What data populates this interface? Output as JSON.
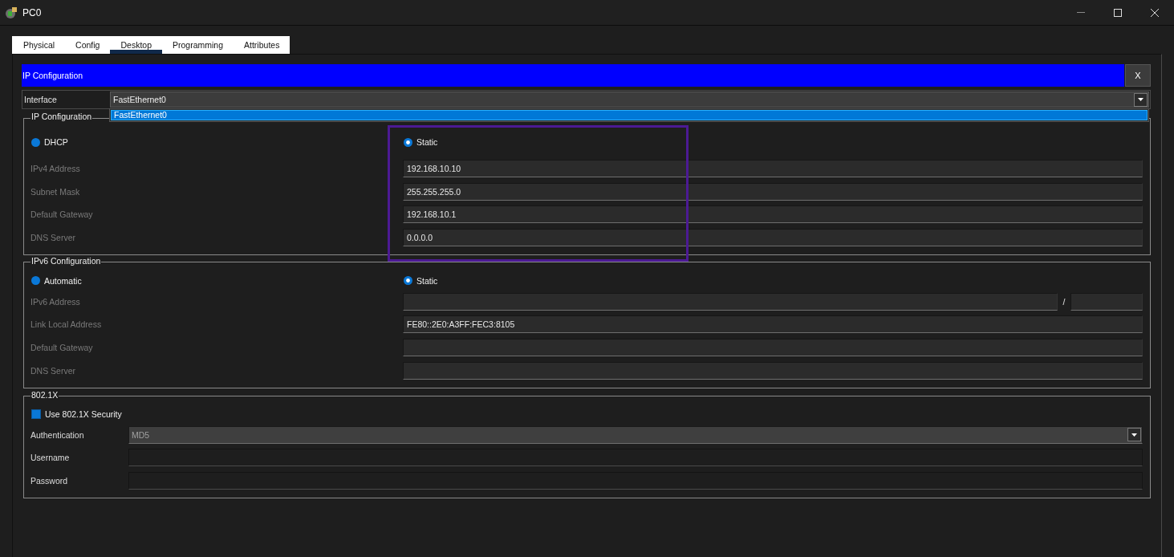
{
  "window": {
    "title": "PC0"
  },
  "tabs": [
    {
      "label": "Physical",
      "selected": false
    },
    {
      "label": "Config",
      "selected": false
    },
    {
      "label": "Desktop",
      "selected": true
    },
    {
      "label": "Programming",
      "selected": false
    },
    {
      "label": "Attributes",
      "selected": false
    }
  ],
  "panel": {
    "title": "IP Configuration",
    "close_label": "X"
  },
  "interface": {
    "label": "Interface",
    "value": "FastEthernet0",
    "expanded": true,
    "options": [
      {
        "label": "FastEthernet0",
        "selected": true
      }
    ]
  },
  "ipv4": {
    "title": "IP Configuration",
    "highlighted": true,
    "modes": [
      {
        "label": "DHCP",
        "selected": false
      },
      {
        "label": "Static",
        "selected": true
      }
    ],
    "fields": [
      {
        "kind": "text",
        "label": "IPv4 Address",
        "value": "192.168.10.10"
      },
      {
        "kind": "text",
        "label": "Subnet Mask",
        "value": "255.255.255.0"
      },
      {
        "kind": "text",
        "label": "Default Gateway",
        "value": "192.168.10.1"
      },
      {
        "kind": "text",
        "label": "DNS Server",
        "value": "0.0.0.0"
      }
    ]
  },
  "ipv6": {
    "title": "IPv6 Configuration",
    "modes": [
      {
        "label": "Automatic",
        "selected": false
      },
      {
        "label": "Static",
        "selected": true
      }
    ],
    "fields": [
      {
        "kind": "prefixed",
        "label": "IPv6 Address",
        "separator": "/"
      },
      {
        "kind": "text",
        "label": "Link Local Address",
        "value": "FE80::2E0:A3FF:FEC3:8105"
      },
      {
        "kind": "text",
        "label": "Default Gateway"
      },
      {
        "kind": "text",
        "label": "DNS Server"
      }
    ]
  },
  "security": {
    "title": "802.1X",
    "option": {
      "label": "Use 802.1X Security",
      "checked": false
    },
    "fields": [
      {
        "kind": "select",
        "label": "Authentication",
        "value": "MD5",
        "disabled": true
      },
      {
        "kind": "text",
        "label": "Username",
        "disabled": true
      },
      {
        "kind": "text",
        "label": "Password",
        "disabled": true
      }
    ]
  }
}
